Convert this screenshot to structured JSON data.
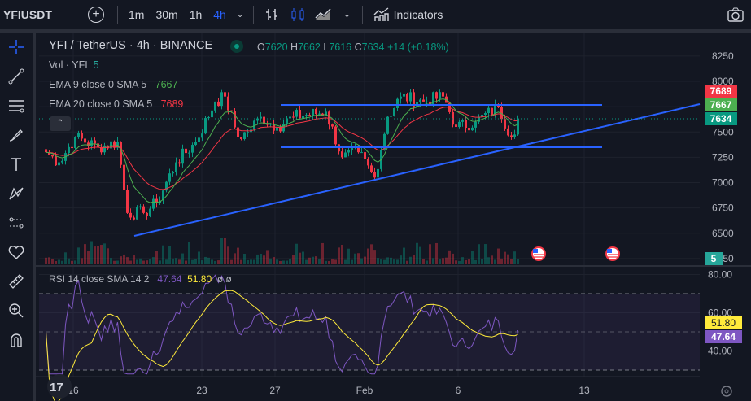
{
  "topbar": {
    "symbol": "YFIUSDT",
    "timeframes": [
      "1m",
      "30m",
      "1h",
      "4h"
    ],
    "active_timeframe": "4h",
    "indicators_label": "Indicators"
  },
  "legend": {
    "title": "YFI / TetherUS · 4h · BINANCE",
    "o_label": "O",
    "o": "7620",
    "h_label": "H",
    "h": "7662",
    "l_label": "L",
    "l": "7616",
    "c_label": "C",
    "c": "7634",
    "change": "+14 (+0.18%)",
    "vol_label": "Vol · YFI",
    "vol_value": "5",
    "ema9_label": "EMA 9 close 0 SMA 5",
    "ema9_value": "7667",
    "ema20_label": "EMA 20 close 0 SMA 5",
    "ema20_value": "7689",
    "rsi_label": "RSI 14 close SMA 14 2",
    "rsi_value": "47.64",
    "rsi_sma_value": "51.80",
    "rsi_extra": "ø ø"
  },
  "price_axis": {
    "ticks": [
      "8250",
      "8000",
      "7750",
      "7500",
      "7250",
      "7000",
      "6750",
      "6500",
      "6250"
    ],
    "tags": {
      "ema20": "7689",
      "ema9": "7667",
      "last": "7634",
      "vol": "5"
    }
  },
  "rsi_axis": {
    "ticks": [
      "80.00",
      "60.00",
      "40.00"
    ],
    "tags": {
      "sma": "51.80",
      "rsi": "47.64"
    }
  },
  "time_axis": {
    "labels": [
      "16",
      "23",
      "27",
      "Feb",
      "6",
      "13"
    ]
  },
  "colors": {
    "up": "#089981",
    "down": "#f23645",
    "ema9": "#4caf50",
    "ema20": "#f23645",
    "trend": "#2962ff",
    "rsi": "#7e57c2",
    "rsi_sma": "#ffeb3b"
  },
  "chart_data": {
    "type": "candlestick",
    "symbol": "YFIUSDT",
    "interval": "4h",
    "ylim": [
      6250,
      8350
    ],
    "close_waypoints": [
      [
        0,
        7300
      ],
      [
        4,
        7200
      ],
      [
        9,
        7450
      ],
      [
        16,
        7350
      ],
      [
        22,
        7400
      ],
      [
        25,
        6700
      ],
      [
        30,
        6700
      ],
      [
        34,
        6800
      ],
      [
        40,
        7200
      ],
      [
        46,
        7400
      ],
      [
        52,
        7800
      ],
      [
        55,
        7850
      ],
      [
        59,
        7450
      ],
      [
        62,
        7500
      ],
      [
        66,
        7650
      ],
      [
        71,
        7550
      ],
      [
        76,
        7650
      ],
      [
        86,
        7700
      ],
      [
        91,
        7250
      ],
      [
        96,
        7300
      ],
      [
        101,
        7050
      ],
      [
        105,
        7650
      ],
      [
        109,
        7850
      ],
      [
        116,
        7800
      ],
      [
        122,
        7850
      ],
      [
        126,
        7550
      ],
      [
        132,
        7600
      ],
      [
        139,
        7750
      ],
      [
        143,
        7450
      ],
      [
        145,
        7634
      ]
    ],
    "drawings": {
      "horizontal_levels": [
        7750,
        7350
      ],
      "trendline": [
        [
          6480,
          7810
        ]
      ]
    }
  }
}
